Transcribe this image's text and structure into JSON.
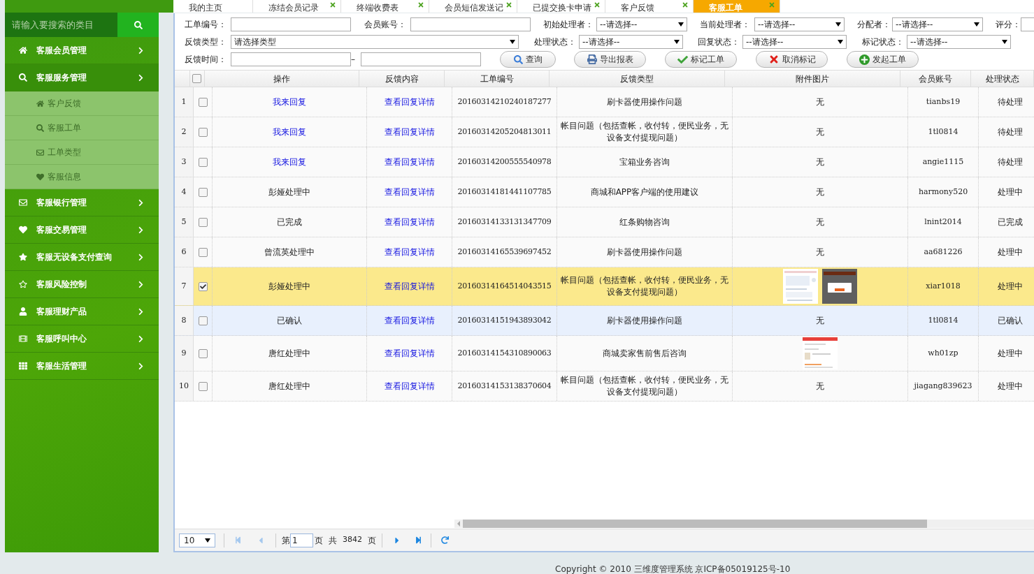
{
  "tabs": [
    {
      "label": "我的主页",
      "closable": false,
      "selected": false
    },
    {
      "label": "冻结会员记录",
      "closable": true,
      "selected": false
    },
    {
      "label": "终端收费表",
      "closable": true,
      "selected": false
    },
    {
      "label": "会员短信发送记",
      "closable": true,
      "selected": false
    },
    {
      "label": "已提交换卡申请",
      "closable": true,
      "selected": false
    },
    {
      "label": "客户反馈",
      "closable": true,
      "selected": false
    },
    {
      "label": "客服工单",
      "closable": true,
      "selected": true
    }
  ],
  "search": {
    "placeholder": "请输入要搜索的类目"
  },
  "sidebar": {
    "items": [
      {
        "label": "客服会员管理",
        "expanded": false
      },
      {
        "label": "客服服务管理",
        "expanded": true,
        "children": [
          {
            "label": "客户反馈"
          },
          {
            "label": "客服工单"
          },
          {
            "label": "工单类型"
          },
          {
            "label": "客服信息"
          }
        ]
      },
      {
        "label": "客服银行管理",
        "expanded": false
      },
      {
        "label": "客服交易管理",
        "expanded": false
      },
      {
        "label": "客服无设备支付查询",
        "expanded": false
      },
      {
        "label": "客服风险控制",
        "expanded": false
      },
      {
        "label": "客服理财产品",
        "expanded": false
      },
      {
        "label": "客服呼叫中心",
        "expanded": false
      },
      {
        "label": "客服生活管理",
        "expanded": false
      }
    ]
  },
  "filters": [
    [
      {
        "label": "工单编号：",
        "kind": "text"
      },
      {
        "label": "会员账号：",
        "kind": "text"
      },
      {
        "label": "初始处理者：",
        "kind": "select",
        "value": "--请选择--"
      },
      {
        "label": "当前处理者：",
        "kind": "select",
        "value": "--请选择--"
      },
      {
        "label": "分配者：",
        "kind": "select",
        "value": "--请选择--"
      },
      {
        "label": "评分：",
        "kind": "cut"
      }
    ],
    [
      {
        "label": "反馈类型：",
        "kind": "select",
        "value": "请选择类型"
      },
      {
        "label": "处理状态：",
        "kind": "select",
        "value": "--请选择--"
      },
      {
        "label": "回复状态：",
        "kind": "select",
        "value": "--请选择--"
      },
      {
        "label": "标记状态：",
        "kind": "select",
        "value": "--请选择--"
      }
    ],
    [
      {
        "label": "反馈时间：",
        "kind": "range",
        "separator": "–"
      }
    ]
  ],
  "buttons": [
    "查询",
    "导出报表",
    "标记工单",
    "取消标记",
    "发起工单"
  ],
  "table": {
    "all_checked": false,
    "columns": [
      "操作",
      "反馈内容",
      "工单编号",
      "反馈类型",
      "附件图片",
      "会员账号",
      "处理状态"
    ],
    "rows": [
      {
        "number": "1",
        "checked": false,
        "hovered": false,
        "action": {
          "text": "我来回复",
          "link": true
        },
        "detail": "查看回复详情",
        "id": "20160314210240187277",
        "type": "刷卡器使用操作问题",
        "attachment": "无",
        "account": "tianbs19",
        "status": "待处理"
      },
      {
        "number": "2",
        "checked": false,
        "hovered": false,
        "action": {
          "text": "我来回复",
          "link": true
        },
        "detail": "查看回复详情",
        "id": "20160314205204813011",
        "type": "帐目问题（包括查帐，收付转，便民业务，无设备支付提现问题）",
        "attachment": "无",
        "account": "1tl0814",
        "status": "待处理"
      },
      {
        "number": "3",
        "checked": false,
        "hovered": false,
        "action": {
          "text": "我来回复",
          "link": true
        },
        "detail": "查看回复详情",
        "id": "20160314200555540978",
        "type": "宝箱业务咨询",
        "attachment": "无",
        "account": "angie1115",
        "status": "待处理"
      },
      {
        "number": "4",
        "checked": false,
        "hovered": false,
        "action": {
          "text": "彭娅处理中",
          "link": false
        },
        "detail": "查看回复详情",
        "id": "20160314181441107785",
        "type": "商城和APP客户端的使用建议",
        "attachment": "无",
        "account": "harmony520",
        "status": "处理中"
      },
      {
        "number": "5",
        "checked": false,
        "hovered": false,
        "action": {
          "text": "已完成",
          "link": false
        },
        "detail": "查看回复详情",
        "id": "20160314133131347709",
        "type": "红条购物咨询",
        "attachment": "无",
        "account": "lnint2014",
        "status": "已完成"
      },
      {
        "number": "6",
        "checked": false,
        "hovered": false,
        "action": {
          "text": "曾流英处理中",
          "link": false
        },
        "detail": "查看回复详情",
        "id": "20160314165539697452",
        "type": "刷卡器使用操作问题",
        "attachment": "无",
        "account": "aa681226",
        "status": "处理中"
      },
      {
        "number": "7",
        "checked": true,
        "hovered": false,
        "action": {
          "text": "彭娅处理中",
          "link": false
        },
        "detail": "查看回复详情",
        "id": "20160314164514043515",
        "type": "帐目问题（包括查帐，收付转，便民业务，无设备支付提现问题）",
        "account": "xiar1018",
        "status": "处理中"
      },
      {
        "number": "8",
        "checked": false,
        "hovered": true,
        "action": {
          "text": "已确认",
          "link": false
        },
        "detail": "查看回复详情",
        "id": "20160314151943893042",
        "type": "刷卡器使用操作问题",
        "attachment": "无",
        "account": "1tl0814",
        "status": "已确认"
      },
      {
        "number": "9",
        "checked": false,
        "hovered": false,
        "action": {
          "text": "唐红处理中",
          "link": false
        },
        "detail": "查看回复详情",
        "id": "20160314154310890063",
        "type": "商城卖家售前售后咨询",
        "account": "wh01zp",
        "status": "处理中"
      },
      {
        "number": "10",
        "checked": false,
        "hovered": false,
        "action": {
          "text": "唐红处理中",
          "link": false
        },
        "detail": "查看回复详情",
        "id": "20160314153138370604",
        "type": "帐目问题（包括查帐，收付转，便民业务，无设备支付提现问题）",
        "attachment": "无",
        "account": "jiagang839623",
        "status": "处理中"
      }
    ]
  },
  "pager": {
    "page_size": "10",
    "page_prefix": "第",
    "page": "1",
    "page_suffix": "页",
    "total_prefix": "共",
    "total": "3842",
    "total_suffix": "页"
  },
  "footer": "Copyright © 2010 三维度管理系统 京ICP备05019125号-10"
}
